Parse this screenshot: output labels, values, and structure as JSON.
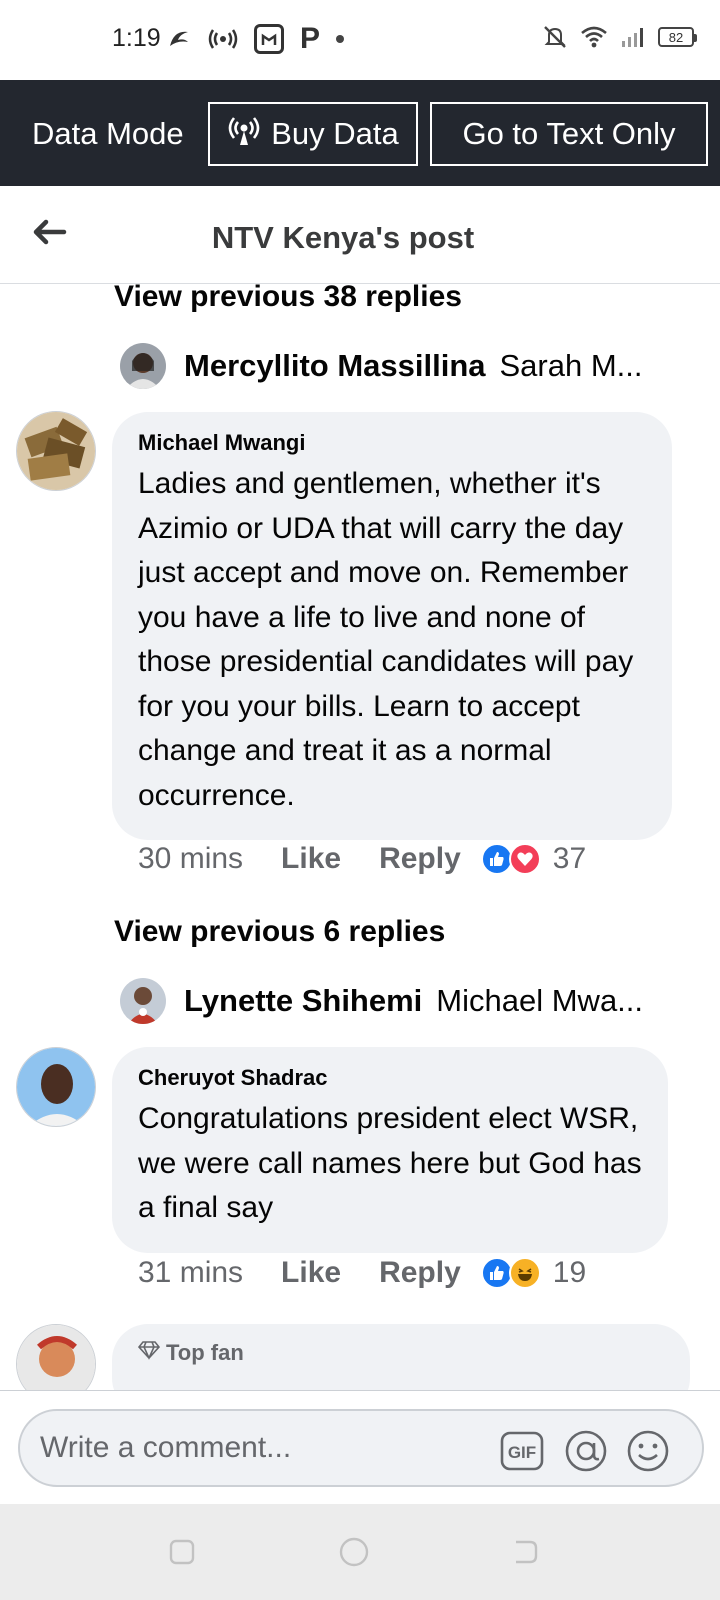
{
  "status_bar": {
    "time": "1:19",
    "battery": "82",
    "icons": [
      "app-icon",
      "radio-icon",
      "screenshot-icon",
      "p-icon",
      "dot-icon",
      "mute-icon",
      "wifi-icon",
      "signal-icon",
      "battery-icon"
    ]
  },
  "data_bar": {
    "mode_label": "Data Mode",
    "buy_data": "Buy Data",
    "text_only": "Go to Text Only"
  },
  "header": {
    "title": "NTV Kenya's post"
  },
  "threads": [
    {
      "view_previous": "View previous 38 replies",
      "reply_preview": {
        "name": "Mercyllito Massillina",
        "text": "Sarah M..."
      },
      "comment": {
        "author": "Michael Mwangi",
        "text": "Ladies and gentlemen, whether it's Azimio or UDA that will carry the day just accept and move on. Remember you have a life to live and none of those presidential candidates will pay for you your bills. Learn to accept change and treat it as a normal occurrence.",
        "time": "30 mins",
        "like": "Like",
        "reply": "Reply",
        "reactions": [
          "like",
          "love"
        ],
        "reaction_count": "37"
      }
    },
    {
      "view_previous": "View previous 6 replies",
      "reply_preview": {
        "name": "Lynette Shihemi",
        "text": "Michael Mwa..."
      },
      "comment": {
        "author": "Cheruyot Shadrac",
        "text": "Congratulations president elect WSR, we were call names here but God has a final say",
        "time": "31 mins",
        "like": "Like",
        "reply": "Reply",
        "reactions": [
          "like",
          "haha"
        ],
        "reaction_count": "19"
      }
    }
  ],
  "partial_comment": {
    "badge": "Top fan"
  },
  "composer": {
    "placeholder": "Write a comment...",
    "gif_label": "GIF"
  },
  "colors": {
    "data_bar_bg": "#23272f",
    "bubble_bg": "#f0f2f5",
    "meta_text": "#65676b",
    "like_blue": "#1877f2",
    "love_red": "#f33e58",
    "haha_yellow": "#f7b125"
  }
}
